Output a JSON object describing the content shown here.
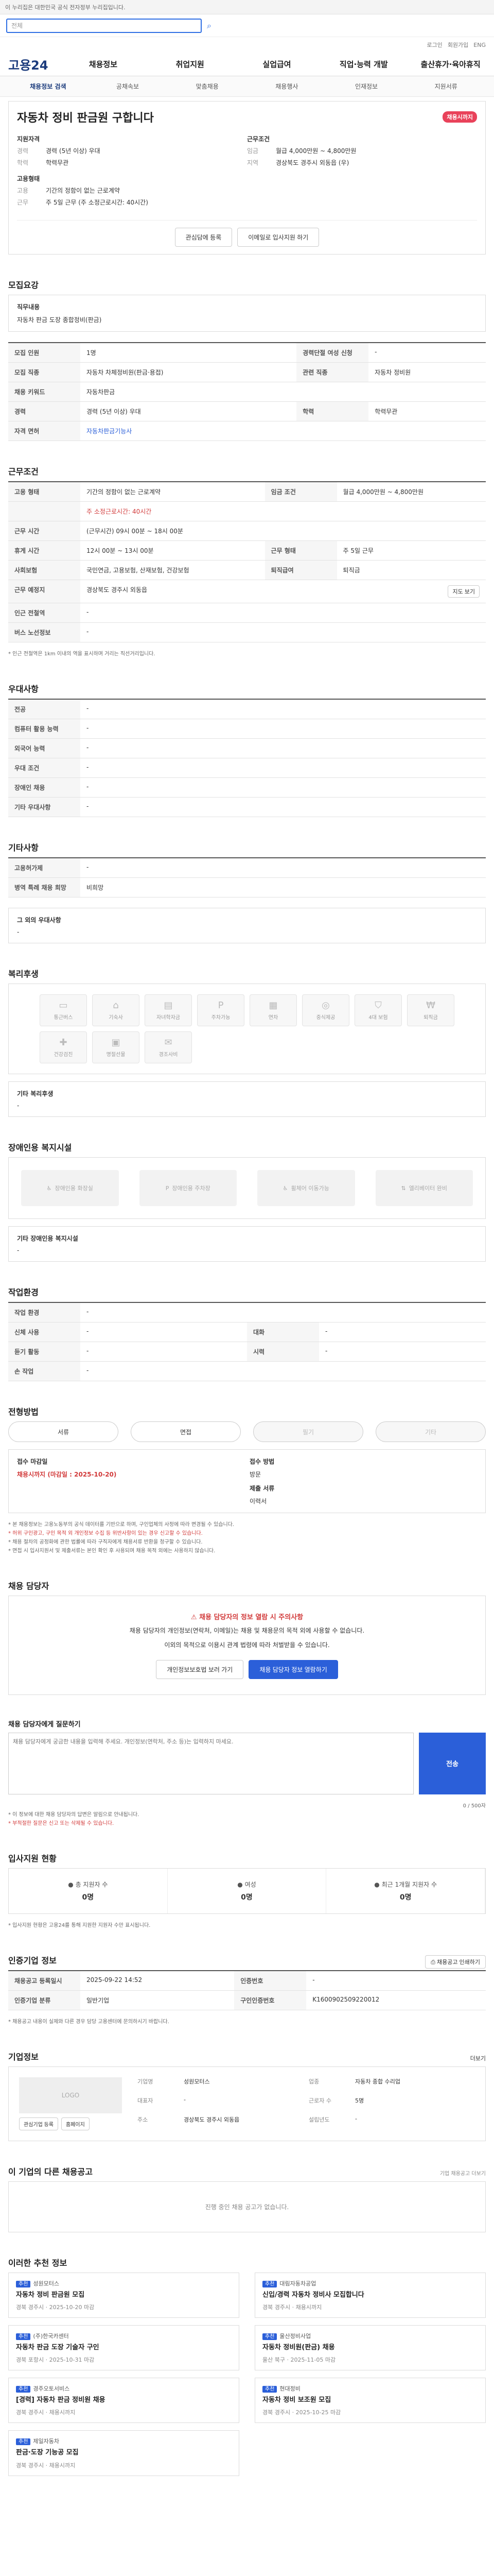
{
  "topbar": {
    "text": "이 누리집은 대한민국 공식 전자정부 누리집입니다."
  },
  "search": {
    "placeholder": "검색어를 입력하세요",
    "text": "전체"
  },
  "lang": {
    "items": [
      "로그인",
      "회원가입",
      "ENG"
    ]
  },
  "gnb": {
    "logo": "고용24",
    "items": [
      "채용정보",
      "취업지원",
      "실업급여",
      "직업·능력 개발",
      "출산휴가·육아휴직"
    ]
  },
  "subnav": {
    "items": [
      "채용정보 검색",
      "공채속보",
      "맞춤채용",
      "채용행사",
      "인재정보",
      "지원서류"
    ]
  },
  "hero": {
    "title": "자동차 정비 판금원 구합니다",
    "badge": "채용시까지",
    "left_head": "지원자격",
    "exp_k": "경력",
    "exp_v": "경력 (5년 이상) 우대",
    "edu_k": "학력",
    "edu_v": "학력무관",
    "work_head": "고용형태",
    "type_k": "고용",
    "type_v": "기간의 정함이 없는 근로계약",
    "time_k": "근무",
    "time_v": "주 5일 근무 (주 소정근로시간: 40시간)",
    "right_head": "근무조건",
    "pay_k": "임금",
    "pay_v": "월급 4,000만원 ~ 4,800만원",
    "loc_k": "지역",
    "loc_v": "경상북도 경주시 외동읍 (우)",
    "btn1": "관심담에 등록",
    "btn2": "이메일로 입사지원 하기"
  },
  "recruit": {
    "title": "모집요강",
    "job_head": "직무내용",
    "job_text": "자동차 판금 도장 종합정비(판금)"
  },
  "detail": {
    "rows": [
      [
        "모집 인원",
        "1명",
        "경력단절 여성 신청",
        "-"
      ],
      [
        "모집 직종",
        "자동차 차체정비원(판금·용접)",
        "관련 직종",
        "자동차 정비원"
      ],
      [
        "채용 키워드",
        "자동차판금",
        "",
        ""
      ],
      [
        "경력",
        "경력 (5년 이상) 우대",
        "학력",
        "학력무관"
      ],
      [
        "자격 면허",
        "자동차판금기능사",
        "",
        ""
      ]
    ]
  },
  "conditions": {
    "title": "근무조건",
    "rows": [
      [
        "고용 형태",
        "기간의 정함이 없는 근로계약",
        "임금 조건",
        "월급 4,000만원 ~ 4,800만원"
      ],
      [
        "",
        "주 소정근로시간: 40시간",
        "",
        ""
      ],
      [
        "근무 시간",
        "(근무시간) 09시 00분 ~ 18시 00분",
        "",
        ""
      ],
      [
        "휴게 시간",
        "12시 00분 ~ 13시 00분",
        "근무 형태",
        "주 5일 근무"
      ],
      [
        "사회보험",
        "국민연금, 고용보험, 산재보험, 건강보험",
        "퇴직급여",
        "퇴직금"
      ],
      [
        "근무 예정지",
        "경상북도 경주시 외동읍",
        "",
        ""
      ],
      [
        "인근 전철역",
        "-",
        "",
        ""
      ],
      [
        "버스 노선정보",
        "-",
        "",
        ""
      ]
    ],
    "map_btn": "지도 보기",
    "note": "* 인근 전철역은 1km 이내의 역을 표시하며 거리는 직선거리입니다."
  },
  "preference": {
    "title": "우대사항",
    "rows": [
      [
        "전공",
        "-"
      ],
      [
        "컴퓨터 활용 능력",
        "-"
      ],
      [
        "외국어 능력",
        "-"
      ],
      [
        "우대 조건",
        "-"
      ],
      [
        "장애인 채용",
        "-"
      ],
      [
        "기타 우대사항",
        "-"
      ]
    ]
  },
  "others": {
    "title": "기타사항",
    "rows": [
      [
        "고용허가제",
        "-"
      ],
      [
        "병역 특례 채용 희망",
        "비희망"
      ]
    ],
    "box_head": "그 외의 우대사항",
    "box_text": "-"
  },
  "welfare": {
    "title": "복리후생",
    "items": [
      "통근버스",
      "기숙사",
      "자녀학자금",
      "주차가능",
      "연차",
      "중식제공",
      "4대 보험",
      "퇴직금"
    ],
    "row2": [
      "건강검진",
      "명절선물",
      "경조사비"
    ],
    "other_head": "기타 복리후생",
    "other_text": "-"
  },
  "disability": {
    "title": "장애인용 복지시설",
    "items": [
      "장애인용 화장실",
      "장애인용 주차장",
      "휠체어 이동가능",
      "엘리베이터 완비"
    ],
    "other_head": "기타 장애인용 복지시설",
    "other_text": "-"
  },
  "worker": {
    "title": "작업환경",
    "rows": [
      [
        "작업 환경",
        "-",
        "",
        ""
      ],
      [
        "신체 사용",
        "-",
        "대화",
        "-"
      ],
      [
        "듣기 활동",
        "-",
        "시력",
        "-"
      ],
      [
        "손 작업",
        "-",
        "",
        ""
      ]
    ]
  },
  "process": {
    "title": "전형방법",
    "steps": [
      "서류",
      "면접",
      "필기",
      "기타"
    ],
    "deadline_k": "접수 마감일",
    "deadline_v": "채용시까지 (마감일 : 2025-10-20)",
    "method_k": "접수 방법",
    "method_v": "방문",
    "docs_k": "제출 서류",
    "docs_v": "이력서",
    "notes": [
      "* 본 채용정보는 고용노동부의 공식 데이터를 기반으로 하며, 구인업체의 사정에 따라 변경될 수 있습니다.",
      "* 허위 구인광고, 구인 목적 외 개인정보 수집 등 위반사항이 있는 경우 신고할 수 있습니다.",
      "* 채용 절차의 공정화에 관한 법률에 따라 구직자에게 채용서류 반환을 청구할 수 있습니다.",
      "* 면접 시 입사지원서 및 제출서류는 본인 확인 후 사용되며 채용 목적 외에는 사용하지 않습니다."
    ]
  },
  "contact": {
    "title": "채용 담당자",
    "warn": "채용 담당자의 정보 열람 시 주의사항",
    "p1": "채용 담당자의 개인정보(연락처, 이메일)는 채용 및 채용문의 목적 외에 사용할 수 없습니다.",
    "p2": "이외의 목적으로 이용시 관계 법령에 따라 처벌받을 수 있습니다.",
    "btn1": "개인정보보호법 보러 가기",
    "btn2": "채용 담당자 정보 열람하기"
  },
  "inquiry": {
    "title": "채용 담당자에게 질문하기",
    "placeholder": "채용 담당자에게 궁금한 내용을 입력해 주세요. 개인정보(연락처, 주소 등)는 입력하지 마세요.",
    "send": "전송",
    "counter": "0 / 500자",
    "note1": "* 이 정보에 대한 채용 담당자의 답변은 알림으로 안내됩니다.",
    "note2": "* 부적절한 질문은 신고 또는 삭제될 수 있습니다."
  },
  "status": {
    "title": "입사지원 현황",
    "items": [
      [
        "총 지원자 수",
        "0명"
      ],
      [
        "여성",
        "0명"
      ],
      [
        "최근 1개월 지원자 수",
        "0명"
      ]
    ],
    "note": "* 입사지원 현황은 고용24를 통해 지원한 지원자 수만 표시됩니다."
  },
  "register": {
    "title": "인증기업 정보",
    "print": "채용공고 인쇄하기",
    "rows": [
      [
        "채용공고 등록일시",
        "2025-09-22 14:52",
        "인증번호",
        "-"
      ],
      [
        "인증기업 분류",
        "일반기업",
        "구인인증번호",
        "K1600902509220012"
      ]
    ],
    "notes": "* 채용공고 내용이 실제와 다른 경우 담당 고용센터에 문의하시기 바랍니다."
  },
  "company": {
    "title": "기업정보",
    "more": "더보기",
    "logo": "LOGO",
    "btn1": "관심기업 등록",
    "btn2": "홈페이지",
    "info": [
      [
        "기업명",
        "성원모터스",
        "업종",
        "자동차 종합 수리업"
      ],
      [
        "대표자",
        "-",
        "근로자 수",
        "5명"
      ],
      [
        "주소",
        "경상북도 경주시 외동읍",
        "설립년도",
        "-"
      ]
    ]
  },
  "other_jobs": {
    "title": "이 기업의 다른 채용공고",
    "more": "기업 채용공고 더보기",
    "empty": "진행 중인 채용 공고가 없습니다."
  },
  "recommend": {
    "title": "이러한 추천 정보",
    "items": [
      {
        "tag": "추천",
        "co": "성원모터스",
        "title": "자동차 정비 판금원 모집",
        "meta": "경북 경주시  ·  2025-10-20 마감"
      },
      {
        "tag": "추천",
        "co": "대림자동차공업",
        "title": "신입/경력 자동차 정비사 모집합니다",
        "meta": "경북 경주시  ·  채용시까지"
      },
      {
        "tag": "추천",
        "co": "(주)한국카센터",
        "title": "자동차 판금 도장 기술자 구인",
        "meta": "경북 포항시  ·  2025-10-31 마감"
      },
      {
        "tag": "추천",
        "co": "울산정비사업",
        "title": "자동차 정비원(판금) 채용",
        "meta": "울산 북구  ·  2025-11-05 마감"
      },
      {
        "tag": "추천",
        "co": "경주오토서비스",
        "title": "[경력] 자동차 판금 정비원 채용",
        "meta": "경북 경주시  ·  채용시까지"
      },
      {
        "tag": "추천",
        "co": "현대정비",
        "title": "자동차 정비 보조원 모집",
        "meta": "경북 경주시  ·  2025-10-25 마감"
      },
      {
        "tag": "추천",
        "co": "제일자동차",
        "title": "판금·도장 기능공 모집",
        "meta": "경북 경주시  ·  채용시까지"
      }
    ]
  }
}
